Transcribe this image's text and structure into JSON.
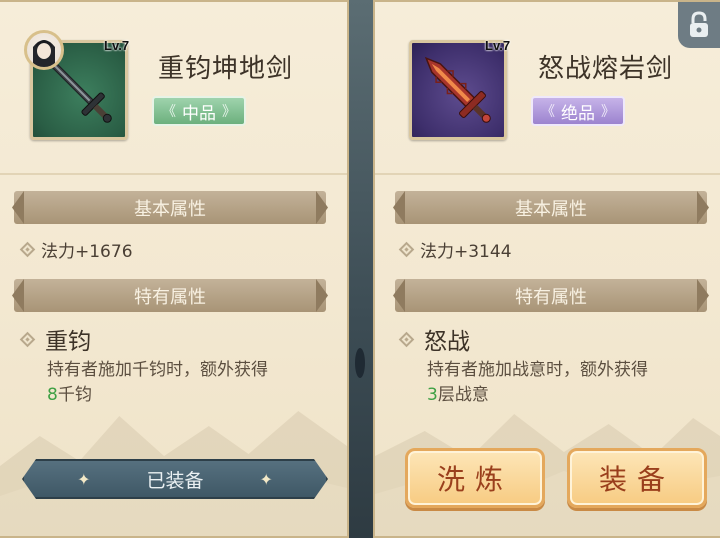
{
  "left_item": {
    "level": "Lv.7",
    "name": "重钧坤地剑",
    "grade": "中品",
    "grade_color": "#6cb07d",
    "basic_section": "基本属性",
    "basic_stat": "法力+1676",
    "special_section": "特有属性",
    "special_name": "重钧",
    "special_desc_line1": "持有者施加千钧时，额外获得",
    "special_desc_num": "8",
    "special_desc_tail": "千钧",
    "status_label": "已装备",
    "icon": "sword-icon"
  },
  "right_item": {
    "level": "Lv.7",
    "name": "怒战熔岩剑",
    "grade": "绝品",
    "grade_color": "#9c83cf",
    "basic_section": "基本属性",
    "basic_stat": "法力+3144",
    "special_section": "特有属性",
    "special_name": "怒战",
    "special_desc_line1": "持有者施加战意时，额外获得",
    "special_desc_num": "3",
    "special_desc_tail": "层战意",
    "refine_label": "洗炼",
    "equip_label": "装备",
    "icon": "lava-sword-icon"
  },
  "colors": {
    "accent_green": "#3ea044",
    "button_text": "#9a3f1c",
    "panel_bg": "#f6edd9"
  }
}
